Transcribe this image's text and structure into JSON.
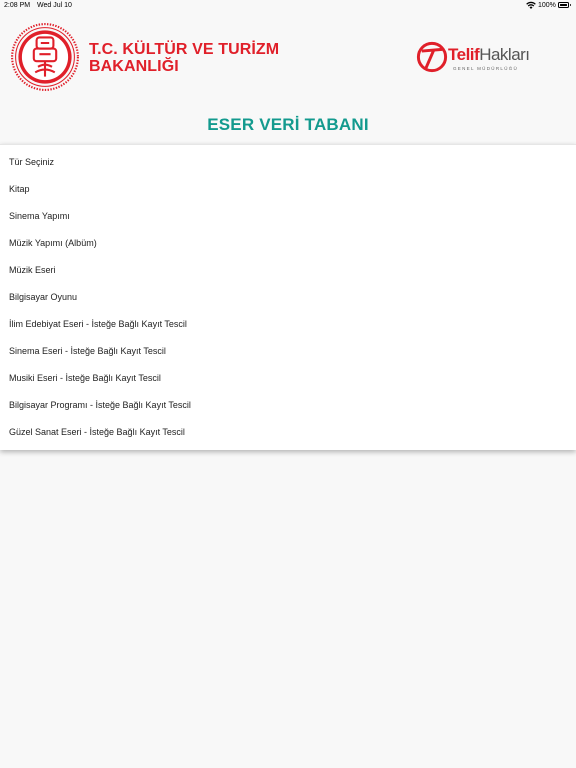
{
  "status_bar": {
    "time": "2:08 PM",
    "date": "Wed Jul 10",
    "battery": "100%",
    "wifi_icon": "wifi-icon",
    "battery_icon": "battery-icon"
  },
  "header": {
    "ministry_line1": "T.C. KÜLTÜR VE TURİZM",
    "ministry_line2": "BAKANLIĞI",
    "telif_name_a": "Telif",
    "telif_name_b": "Hakları",
    "telif_sub": "GENEL MÜDÜRLÜĞÜ",
    "brand_red": "#e0202a"
  },
  "page": {
    "title": "ESER VERİ TABANI",
    "title_color": "#139a8e"
  },
  "dropdown": {
    "placeholder": "Tür Seçiniz",
    "options": [
      "Kitap",
      "Sinema Yapımı",
      "Müzik Yapımı (Albüm)",
      "Müzik Eseri",
      "Bilgisayar Oyunu",
      "İlim Edebiyat Eseri - İsteğe Bağlı Kayıt Tescil",
      "Sinema Eseri - İsteğe Bağlı Kayıt Tescil",
      "Musiki Eseri - İsteğe Bağlı Kayıt Tescil",
      "Bilgisayar Programı - İsteğe Bağlı Kayıt Tescil",
      "Güzel Sanat Eseri - İsteğe Bağlı Kayıt Tescil"
    ]
  }
}
